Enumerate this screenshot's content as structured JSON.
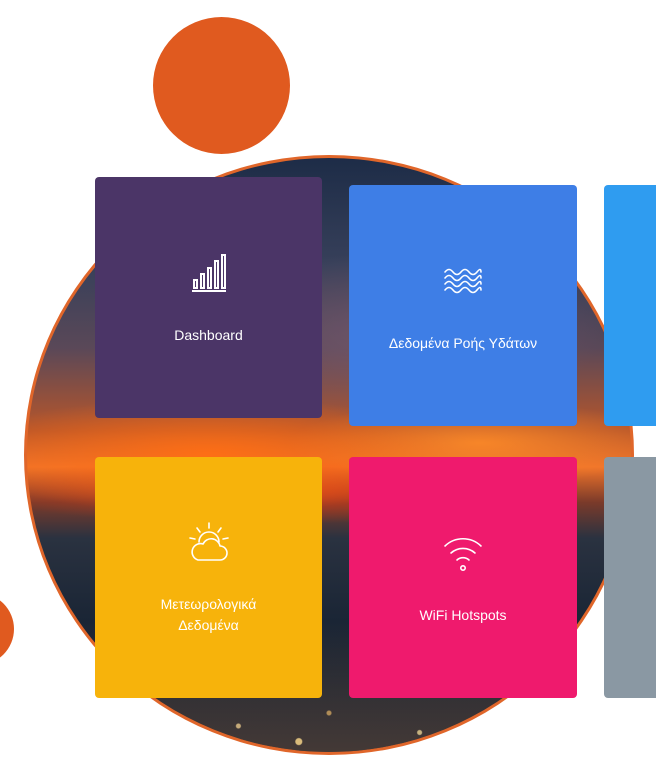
{
  "tiles": [
    {
      "id": "dashboard",
      "label": "Dashboard",
      "icon": "bar-chart-icon",
      "color": "#4b3567"
    },
    {
      "id": "water",
      "label": "Δεδομένα Ροής Υδάτων",
      "icon": "waves-icon",
      "color": "#3e7ee6"
    },
    {
      "id": "weather",
      "label": "Μετεωρολογικά\nΔεδομένα",
      "label_lines": [
        "Μετεωρολογικά",
        "Δεδομένα"
      ],
      "icon": "cloud-sun-icon",
      "color": "#f7b30b"
    },
    {
      "id": "wifi",
      "label": "WiFi Hotspots",
      "icon": "wifi-icon",
      "color": "#ef1a6d"
    }
  ],
  "partial_tiles": [
    {
      "color": "#2f9cf0"
    },
    {
      "color": "#8a98a3"
    }
  ],
  "accent_color": "#e05a1f"
}
